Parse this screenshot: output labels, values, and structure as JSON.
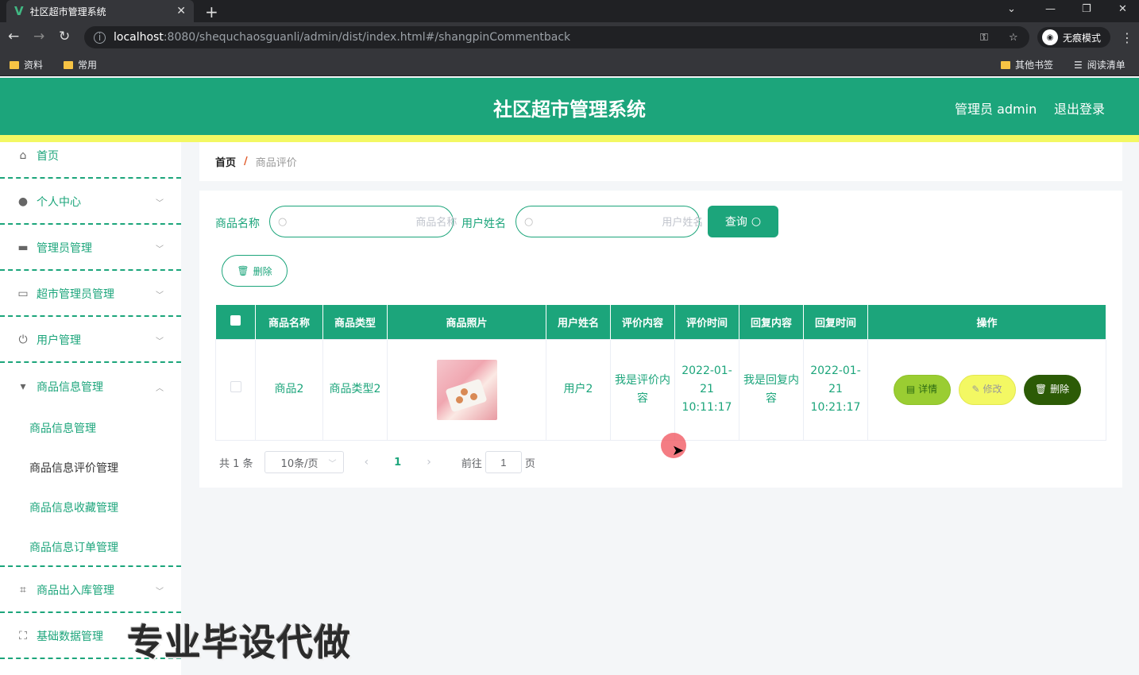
{
  "browser": {
    "tab_title": "社区超市管理系统",
    "tab_close": "✕",
    "url_host": "localhost",
    "url_rest": ":8080/shequchaosguanli/admin/dist/index.html#/shangpinCommentback",
    "incognito_label": "无痕模式",
    "bookmarks": [
      "资料",
      "常用"
    ],
    "other_bookmarks": "其他书签",
    "reading_list": "阅读清单"
  },
  "header": {
    "title": "社区超市管理系统",
    "user": "管理员 admin",
    "logout": "退出登录"
  },
  "sidebar": {
    "items": [
      {
        "label": "首页"
      },
      {
        "label": "个人中心"
      },
      {
        "label": "管理员管理"
      },
      {
        "label": "超市管理员管理"
      },
      {
        "label": "用户管理"
      },
      {
        "label": "商品信息管理"
      },
      {
        "label": "商品出入库管理"
      },
      {
        "label": "基础数据管理"
      }
    ],
    "submenu": [
      "商品信息管理",
      "商品信息评价管理",
      "商品信息收藏管理",
      "商品信息订单管理"
    ]
  },
  "breadcrumb": {
    "home": "首页",
    "separator": "/",
    "current": "商品评价"
  },
  "search": {
    "product_label": "商品名称",
    "product_placeholder": "商品名称",
    "user_label": "用户姓名",
    "user_placeholder": "用户姓名",
    "query_button": "查询"
  },
  "toolbar": {
    "delete_label": "删除"
  },
  "table": {
    "columns": [
      "商品名称",
      "商品类型",
      "商品照片",
      "用户姓名",
      "评价内容",
      "评价时间",
      "回复内容",
      "回复时间",
      "操作"
    ],
    "rows": [
      {
        "product_name": "商品2",
        "product_type": "商品类型2",
        "user_name": "用户2",
        "comment": "我是评价内容",
        "comment_time": "2022-01-21 10:11:17",
        "reply": "我是回复内容",
        "reply_time": "2022-01-21 10:21:17",
        "actions": {
          "detail": "详情",
          "edit": "修改",
          "delete": "删除"
        }
      }
    ]
  },
  "pagination": {
    "total": "共 1 条",
    "page_size": "10条/页",
    "current_page": "1",
    "goto_label": "前往",
    "goto_value": "1",
    "page_suffix": "页"
  },
  "watermark": "专业毕设代做",
  "colors": {
    "primary": "#1ca57b",
    "accent_yellow": "#f3f863",
    "dark_green": "#2c5b06",
    "lime": "#9acd32"
  }
}
